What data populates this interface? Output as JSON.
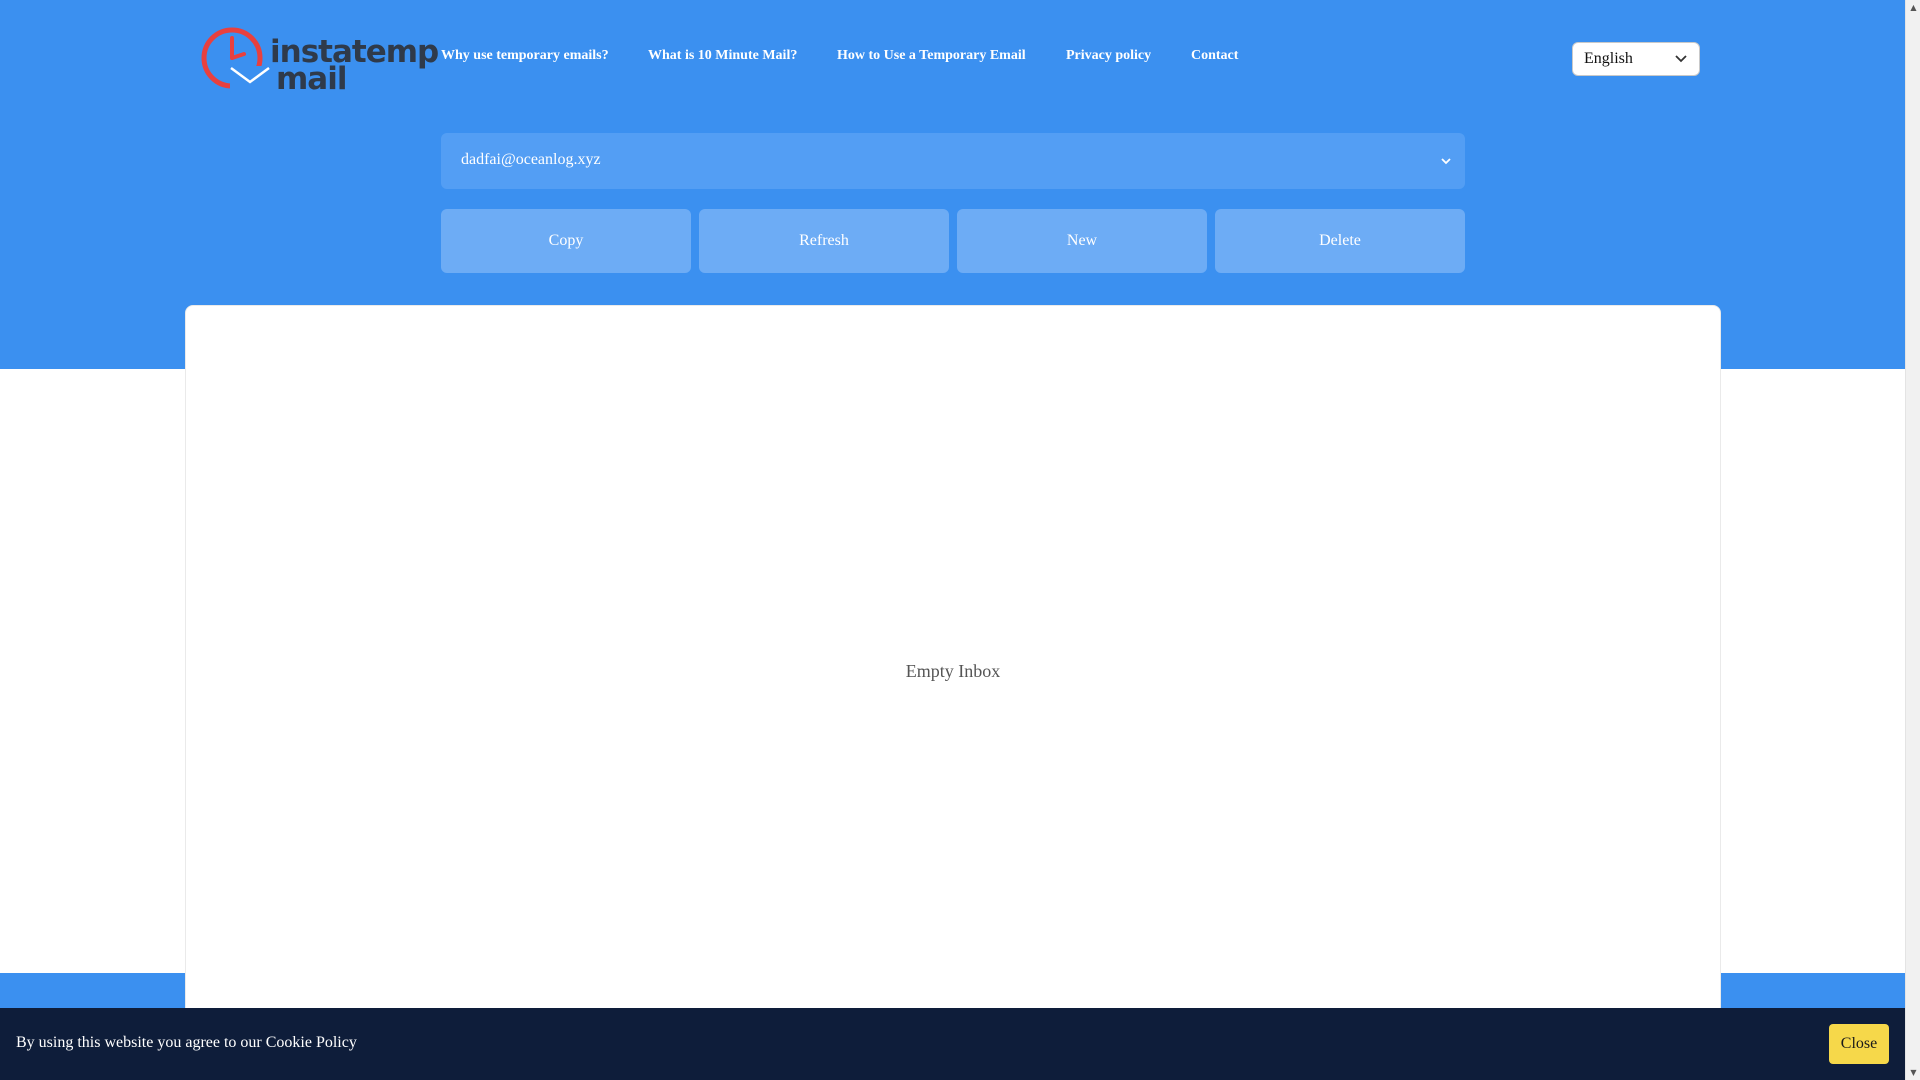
{
  "brand": {
    "logo_line1": "instatemp",
    "logo_line2": "mail",
    "clock_color": "#e8403f",
    "envelope_color": "#3b90f0"
  },
  "nav": {
    "items": [
      {
        "label": "Why use temporary emails?"
      },
      {
        "label": "What is 10 Minute Mail?"
      },
      {
        "label": "How to Use a Temporary Email"
      },
      {
        "label": "Privacy policy"
      },
      {
        "label": "Contact"
      }
    ]
  },
  "language": {
    "selected": "English"
  },
  "email": {
    "address": "dadfai@oceanlog.xyz"
  },
  "actions": {
    "copy": "Copy",
    "refresh": "Refresh",
    "new": "New",
    "delete": "Delete"
  },
  "inbox": {
    "empty_text": "Empty Inbox"
  },
  "cookie_banner": {
    "message": "By using this website you agree to our Cookie Policy",
    "close_label": "Close"
  },
  "colors": {
    "primary": "#3b90f0",
    "banner_bg": "#0e1d3a",
    "close_button": "#f6d84a"
  }
}
